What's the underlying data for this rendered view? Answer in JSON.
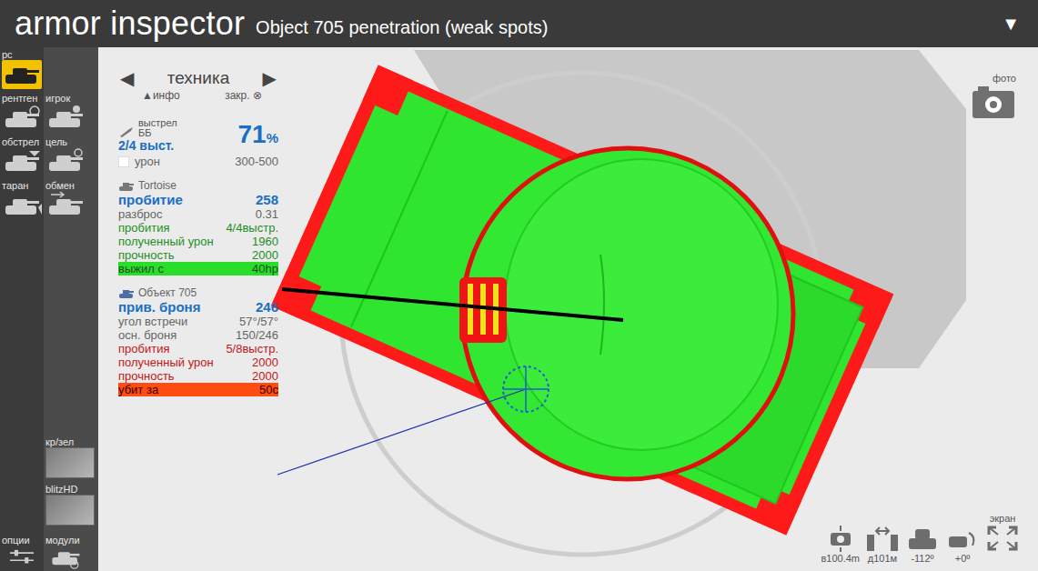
{
  "window": {
    "title": "armor inspector",
    "subtitle": "Object 705 penetration (weak spots)",
    "menu_icon": "▼"
  },
  "sidebar": {
    "items": [
      {
        "label": "рс",
        "selected": true
      },
      {
        "label": "рентген",
        "selected": false
      },
      {
        "label": "игрок",
        "selected": false
      },
      {
        "label": "обстрел",
        "selected": false
      },
      {
        "label": "цель",
        "selected": false
      },
      {
        "label": "таран",
        "selected": false
      },
      {
        "label": "обмен",
        "selected": false
      }
    ],
    "lower": [
      {
        "label": "кр/зел",
        "selected": false
      },
      {
        "label": "blitzHD",
        "selected": false
      }
    ],
    "bottom": [
      {
        "label": "опции",
        "selected": false
      },
      {
        "label": "модули",
        "selected": false
      }
    ]
  },
  "panel": {
    "prev": "◀",
    "title": "техника",
    "next": "▶",
    "info": "▲инфо",
    "close": "закр. ⊗",
    "shot": {
      "label": "выстрел",
      "ammo": "ББ",
      "shots": "2/4 выст.",
      "percent": "71",
      "percent_unit": "%",
      "damage_label": "урон",
      "damage_checked": false,
      "damage": "300-500"
    },
    "attacker": {
      "name": "Tortoise",
      "rows": [
        {
          "label": "пробитие",
          "value": "258",
          "kind": "key"
        },
        {
          "label": "разброс",
          "value": "0.31",
          "kind": "info"
        },
        {
          "label": "пробития",
          "value": "4/4выстр.",
          "kind": "good"
        },
        {
          "label": "полученный урон",
          "value": "1960",
          "kind": "good"
        },
        {
          "label": "прочность",
          "value": "2000",
          "kind": "good"
        },
        {
          "label": "выжил с",
          "value": "40hp",
          "kind": "good_bar"
        }
      ]
    },
    "target": {
      "name": "Объект 705",
      "rows": [
        {
          "label": "прив. броня",
          "value": "246",
          "kind": "key"
        },
        {
          "label": "угол встречи",
          "value": "57°/57°",
          "kind": "info"
        },
        {
          "label": "осн. броня",
          "value": "150/246",
          "kind": "info"
        },
        {
          "label": "пробития",
          "value": "5/8выстр.",
          "kind": "bad"
        },
        {
          "label": "полученный урон",
          "value": "2000",
          "kind": "bad"
        },
        {
          "label": "прочность",
          "value": "2000",
          "kind": "bad"
        },
        {
          "label": "убит за",
          "value": "50с",
          "kind": "bad_bar"
        }
      ]
    }
  },
  "photo": {
    "label": "фото"
  },
  "toolbar": {
    "screen_label": "экран",
    "items": [
      {
        "label": "в100.4m"
      },
      {
        "label": "д101м"
      },
      {
        "label": "-112º"
      },
      {
        "label": "+0º"
      }
    ]
  }
}
